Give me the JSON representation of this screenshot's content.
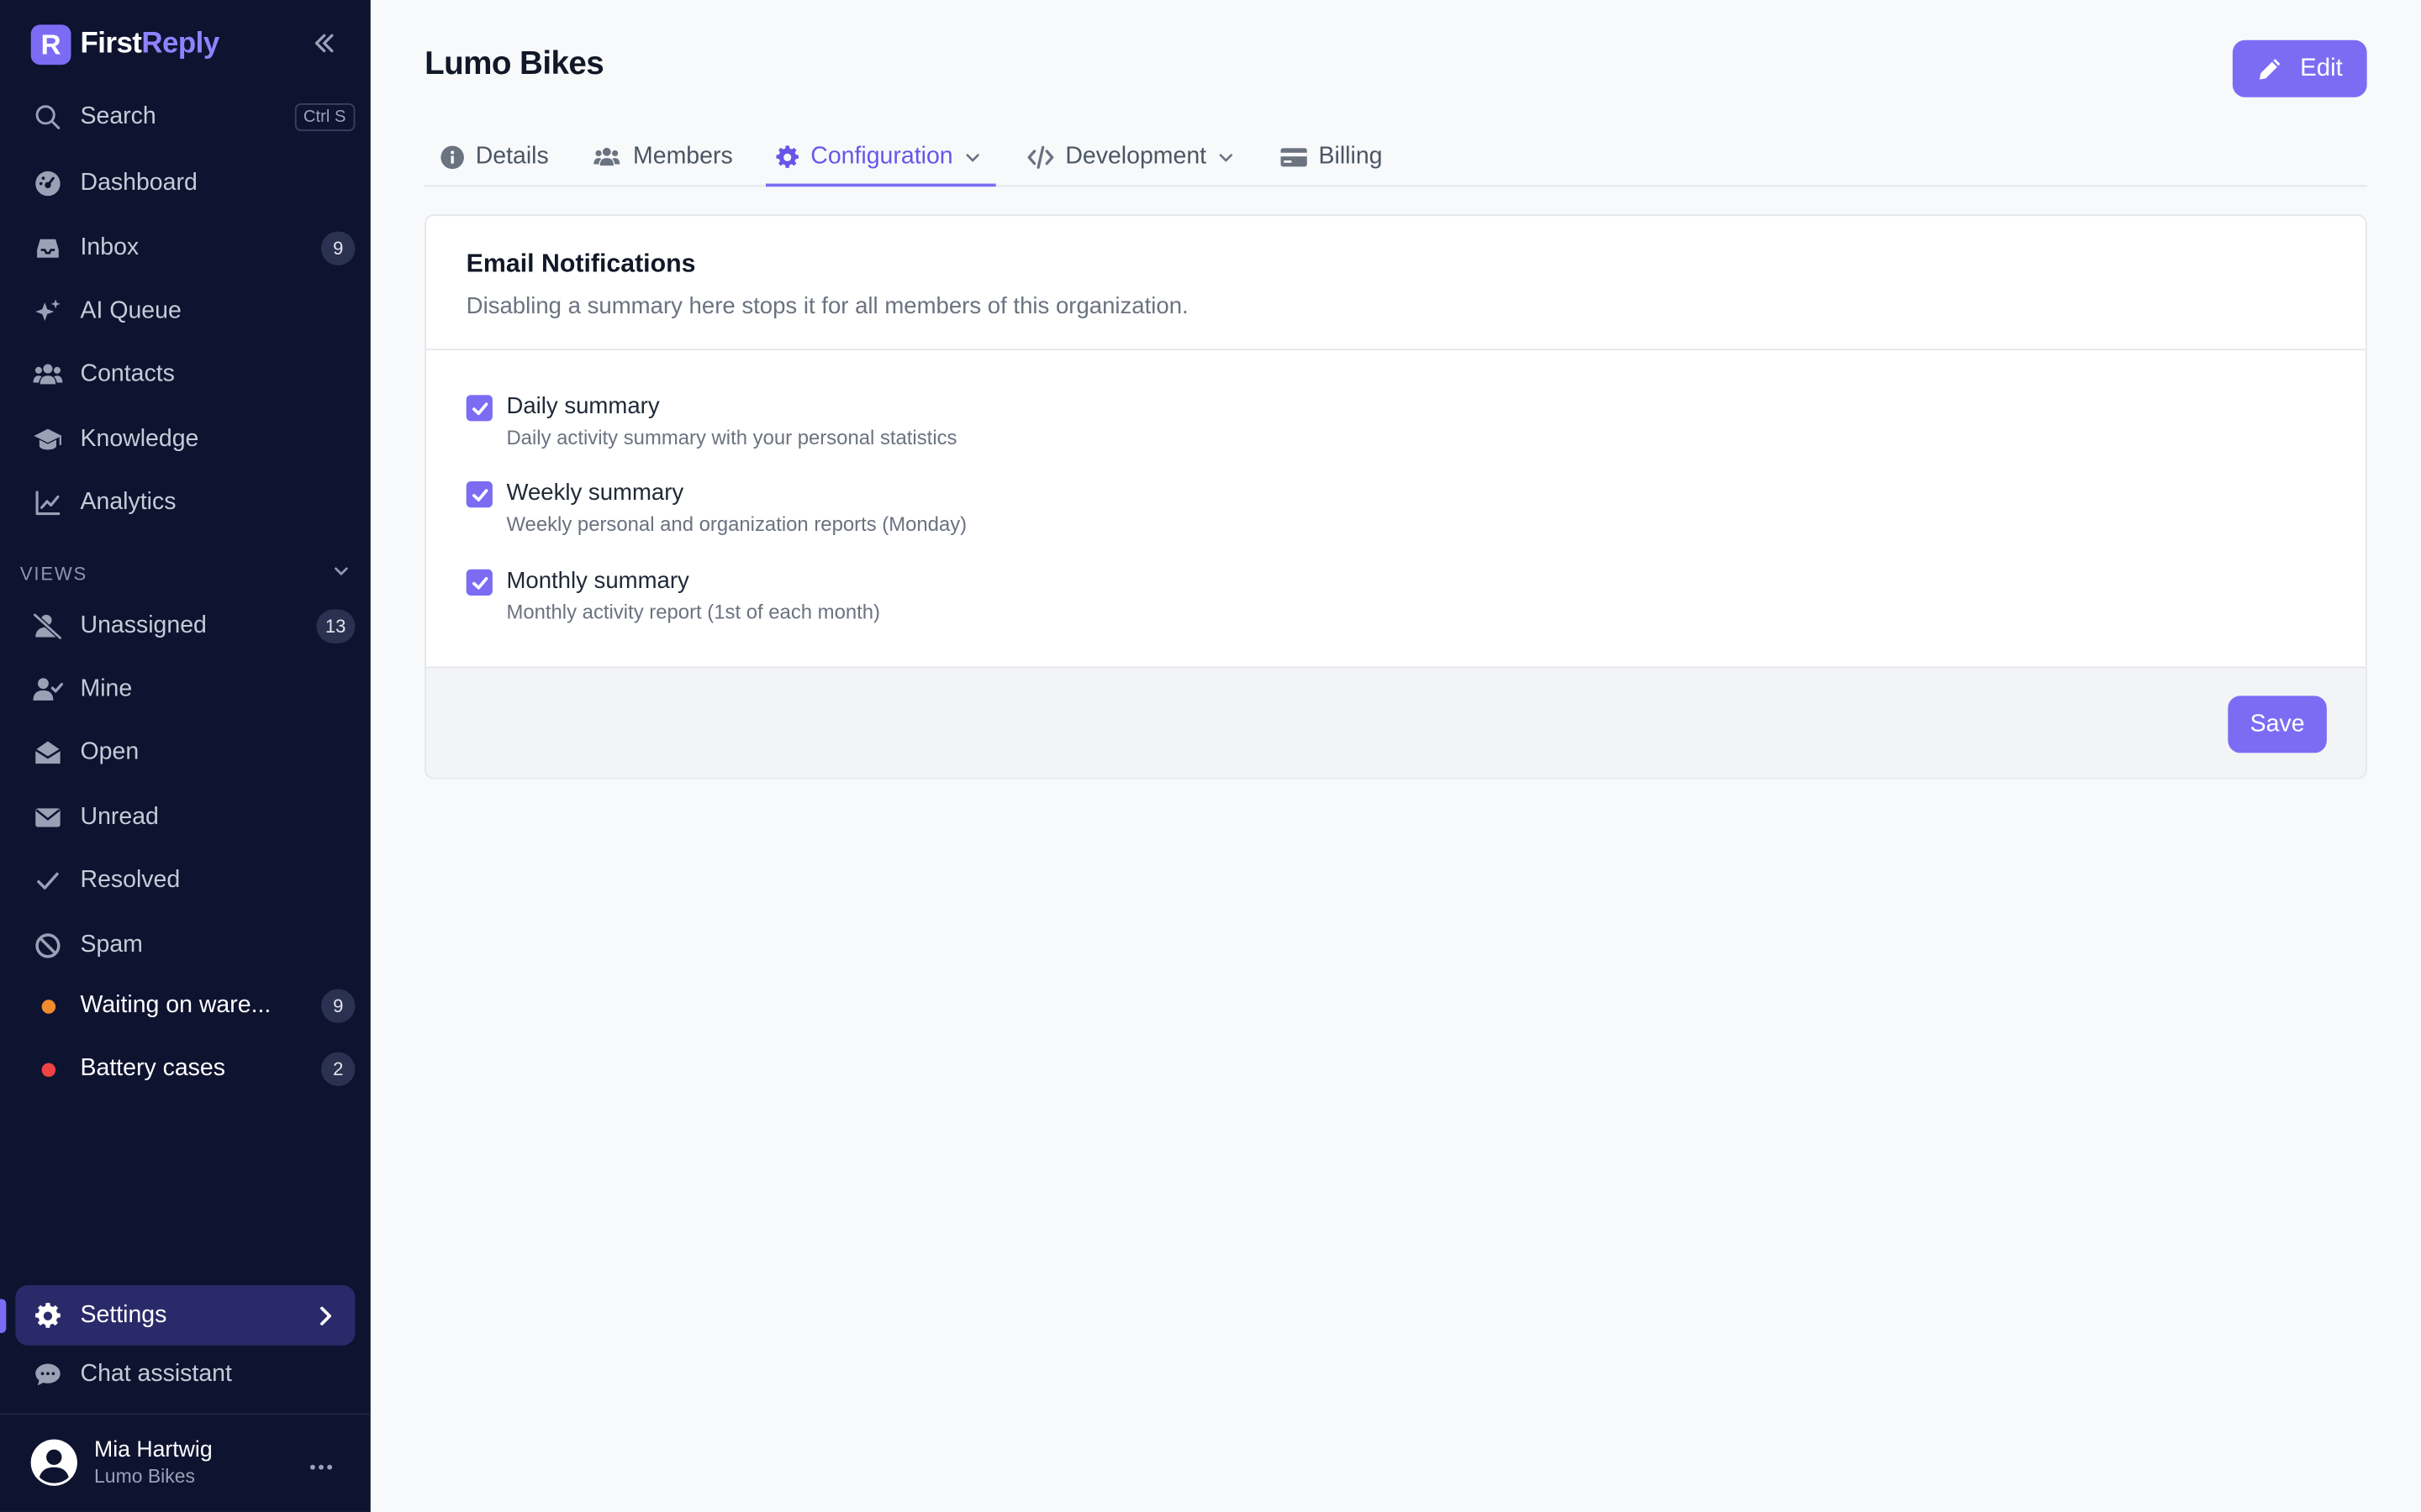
{
  "brand": {
    "logo_letter": "R",
    "name_part1": "First",
    "name_part2": "Reply"
  },
  "sidebar": {
    "search": {
      "label": "Search",
      "shortcut": "Ctrl S"
    },
    "items": [
      {
        "label": "Dashboard",
        "icon": "gauge-icon"
      },
      {
        "label": "Inbox",
        "icon": "inbox-icon",
        "count": "9"
      },
      {
        "label": "AI Queue",
        "icon": "sparkles-icon"
      },
      {
        "label": "Contacts",
        "icon": "users-icon"
      },
      {
        "label": "Knowledge",
        "icon": "graduation-cap-icon"
      },
      {
        "label": "Analytics",
        "icon": "chart-line-icon"
      }
    ],
    "views_header": "VIEWS",
    "views": [
      {
        "label": "Unassigned",
        "icon": "user-slash-icon",
        "count": "13"
      },
      {
        "label": "Mine",
        "icon": "user-check-icon"
      },
      {
        "label": "Open",
        "icon": "envelope-open-icon"
      },
      {
        "label": "Unread",
        "icon": "envelope-icon"
      },
      {
        "label": "Resolved",
        "icon": "check-icon"
      },
      {
        "label": "Spam",
        "icon": "ban-icon"
      },
      {
        "label": "Waiting on ware...",
        "icon": "dot-icon",
        "count": "9",
        "color": "#f08c2e"
      },
      {
        "label": "Battery cases",
        "icon": "dot-icon",
        "count": "2",
        "color": "#ef4444"
      }
    ],
    "settings": {
      "label": "Settings"
    },
    "chat_assistant": {
      "label": "Chat assistant"
    },
    "user": {
      "name": "Mia Hartwig",
      "org": "Lumo Bikes"
    }
  },
  "main": {
    "title": "Lumo Bikes",
    "edit_label": "Edit",
    "tabs": [
      {
        "label": "Details",
        "icon": "info-circle-icon"
      },
      {
        "label": "Members",
        "icon": "users-icon"
      },
      {
        "label": "Configuration",
        "icon": "gear-icon",
        "active": true,
        "dropdown": true
      },
      {
        "label": "Development",
        "icon": "code-icon",
        "dropdown": true
      },
      {
        "label": "Billing",
        "icon": "credit-card-icon"
      }
    ],
    "card": {
      "title": "Email Notifications",
      "subtitle": "Disabling a summary here stops it for all members of this organization.",
      "options": [
        {
          "title": "Daily summary",
          "desc": "Daily activity summary with your personal statistics",
          "checked": true
        },
        {
          "title": "Weekly summary",
          "desc": "Weekly personal and organization reports (Monday)",
          "checked": true
        },
        {
          "title": "Monthly summary",
          "desc": "Monthly activity report (1st of each month)",
          "checked": true
        }
      ],
      "save_label": "Save"
    }
  },
  "colors": {
    "accent": "#7c6cf4",
    "sidebar_bg": "#0e1330",
    "active_nav_bg": "#2a2a6a"
  }
}
